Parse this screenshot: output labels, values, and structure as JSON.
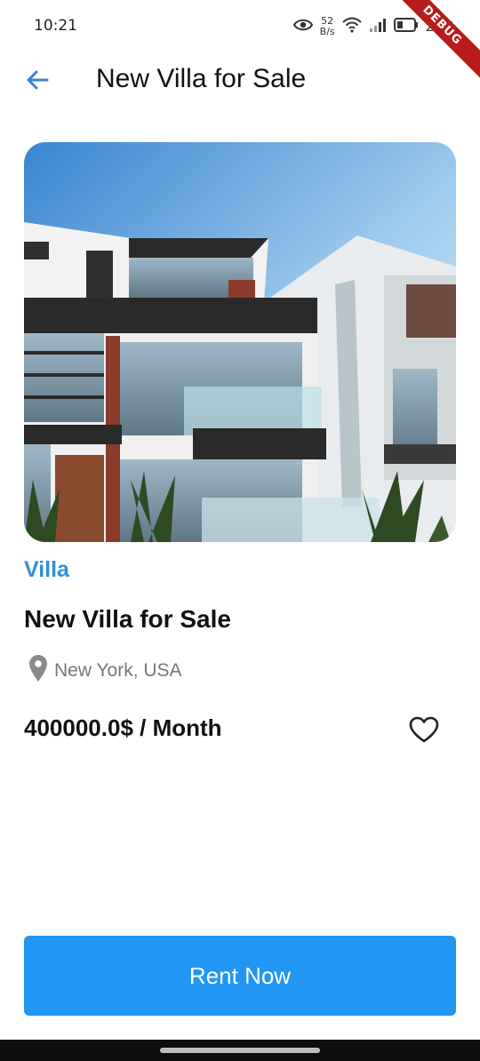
{
  "status_bar": {
    "time": "10:21",
    "net_speed_value": "52",
    "net_speed_unit": "B/s",
    "battery_percent": "27%",
    "icons": [
      "eye-icon",
      "wifi-icon",
      "signal-icon",
      "battery-icon"
    ]
  },
  "debug_banner": "DEBUG",
  "app_bar": {
    "back_icon": "arrow-back-icon",
    "title": "New Villa for Sale"
  },
  "property": {
    "image": "villa-photo",
    "category": "Villa",
    "title": "New Villa for Sale",
    "location_icon": "location-pin-icon",
    "location": "New York, USA",
    "price": "400000.0$ / Month",
    "favorite_icon": "heart-outline-icon",
    "favorited": false
  },
  "actions": {
    "rent_label": "Rent Now"
  },
  "colors": {
    "accent": "#2f8fd8",
    "button": "#2196f3",
    "text_primary": "#111111",
    "text_secondary": "#777777"
  }
}
